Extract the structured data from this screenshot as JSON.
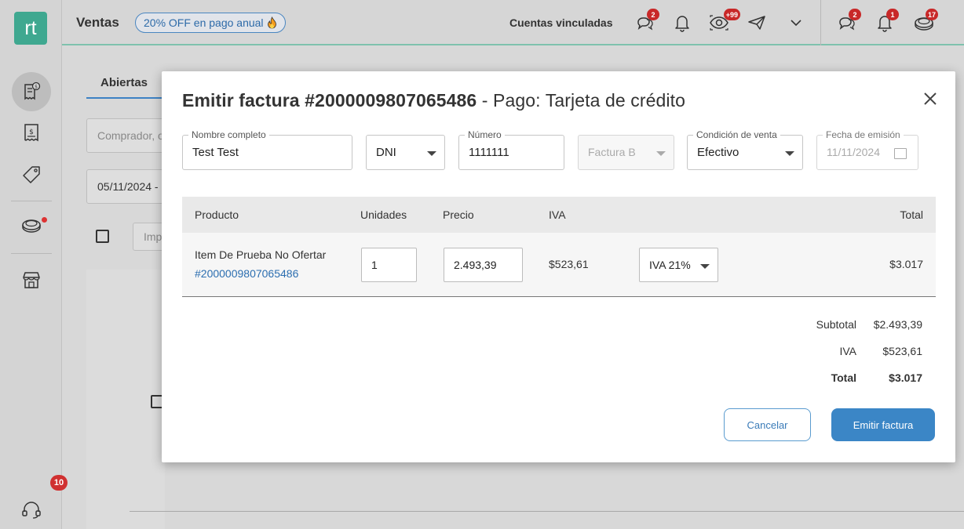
{
  "sidebar": {
    "logo": "rt",
    "items": [
      {
        "icon": "receipt-dollar-icon",
        "active": true
      },
      {
        "icon": "invoice-dollar-icon",
        "active": false
      },
      {
        "icon": "price-tag-icon",
        "active": false
      },
      {
        "icon": "coins-icon",
        "active": false,
        "dot": true
      },
      {
        "icon": "store-icon",
        "active": false
      }
    ],
    "help": {
      "icon": "headset-icon",
      "badge": "10"
    }
  },
  "topbar": {
    "title": "Ventas",
    "promo": "20% OFF en pago anual",
    "promo_icon": "fire-icon",
    "linked_accounts": "Cuentas vinculadas",
    "icons": [
      {
        "name": "chat-icon",
        "badge": "2"
      },
      {
        "name": "bell-icon",
        "badge": ""
      },
      {
        "name": "eye-icon",
        "badge": "+99"
      },
      {
        "name": "send-icon",
        "badge": ""
      },
      {
        "name": "chevron-down-icon",
        "badge": ""
      },
      {
        "name": "chat-icon",
        "badge": "2"
      },
      {
        "name": "bell-icon",
        "badge": "1"
      },
      {
        "name": "coins-icon",
        "badge": "17"
      }
    ]
  },
  "background": {
    "tab_open": "Abiertas",
    "buyer_placeholder": "Comprador, o",
    "date_range": "05/11/2024 -",
    "import_placeholder": "Imp"
  },
  "modal": {
    "title_bold": "Emitir factura #2000009807065486",
    "title_rest": " - Pago: Tarjeta de crédito",
    "fields": {
      "full_name": {
        "label": "Nombre completo",
        "value": "Test Test"
      },
      "doc_type": {
        "value": "DNI"
      },
      "number": {
        "label": "Número",
        "value": "1111111"
      },
      "invoice_type": {
        "value": "Factura B"
      },
      "sale_condition": {
        "label": "Condición de venta",
        "value": "Efectivo"
      },
      "issue_date": {
        "label": "Fecha de emisión",
        "value": "11/11/2024"
      }
    },
    "table": {
      "headers": {
        "product": "Producto",
        "units": "Unidades",
        "price": "Precio",
        "iva": "IVA",
        "total": "Total"
      },
      "row": {
        "product_name": "Item De Prueba No Ofertar",
        "product_id": "#2000009807065486",
        "units": "1",
        "price": "2.493,39",
        "iva_amount": "$523,61",
        "iva_rate": "IVA 21%",
        "total": "$3.017"
      }
    },
    "summary": {
      "subtotal_label": "Subtotal",
      "subtotal": "$2.493,39",
      "iva_label": "IVA",
      "iva": "$523,61",
      "total_label": "Total",
      "total": "$3.017"
    },
    "buttons": {
      "cancel": "Cancelar",
      "emit": "Emitir factura"
    }
  },
  "colors": {
    "brand": "#3fa890",
    "accent": "#3b86c6",
    "badge": "#c82828",
    "link": "#2c6eb0"
  }
}
